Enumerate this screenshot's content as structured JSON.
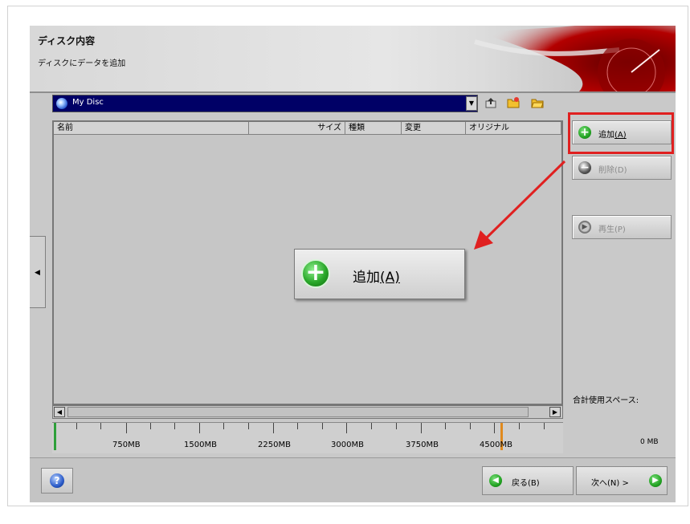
{
  "header": {
    "title": "ディスク内容",
    "subtitle": "ディスクにデータを追加"
  },
  "drive": {
    "name": "My Disc"
  },
  "file_list": {
    "columns": [
      "名前",
      "サイズ",
      "種類",
      "変更",
      "オリジナル"
    ]
  },
  "capacity_ruler": {
    "labels": [
      "750MB",
      "1500MB",
      "2250MB",
      "3000MB",
      "3750MB",
      "4500MB"
    ]
  },
  "actions": {
    "add": {
      "label": "追加",
      "mnemonic": "(A)"
    },
    "delete": {
      "label": "削除",
      "mnemonic": "(D)"
    },
    "play": {
      "label": "再生",
      "mnemonic": "(P)"
    }
  },
  "usage": {
    "label": "合計使用スペース:",
    "value": "0 MB"
  },
  "navigation": {
    "back": "戻る(B)",
    "next": "次へ(N) >"
  },
  "zoom_callout": {
    "label": "追加",
    "mnemonic": "(A)"
  },
  "colors": {
    "highlight": "#e02020",
    "drive_bar": "#000066",
    "accent_green": "#23a323"
  }
}
